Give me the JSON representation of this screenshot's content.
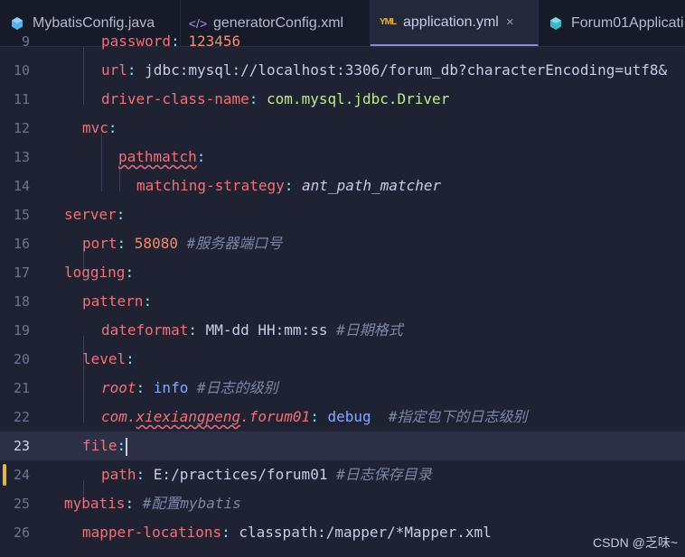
{
  "tabs": [
    {
      "label": "MybatisConfig.java",
      "icon": "java-class-icon",
      "active": false
    },
    {
      "label": "generatorConfig.xml",
      "icon": "xml-tag-icon",
      "active": false
    },
    {
      "label": "application.yml",
      "icon": "yaml-icon",
      "active": true,
      "close": "×"
    },
    {
      "label": "Forum01Applicati",
      "icon": "java-class-icon",
      "active": false
    }
  ],
  "yaml_icon_text": "YML",
  "editor": {
    "current_line": "23",
    "lines": [
      {
        "num": "9",
        "text": "password: 123456"
      },
      {
        "num": "10",
        "text": "url: jdbc:mysql://localhost:3306/forum_db?characterEncoding=utf8&"
      },
      {
        "num": "11",
        "text": "driver-class-name: com.mysql.jdbc.Driver"
      },
      {
        "num": "12",
        "text": "mvc:"
      },
      {
        "num": "13",
        "text": "pathmatch:"
      },
      {
        "num": "14",
        "text": "matching-strategy: ant_path_matcher"
      },
      {
        "num": "15",
        "text": "server:"
      },
      {
        "num": "16",
        "text": "port: 58080 #服务器端口号"
      },
      {
        "num": "17",
        "text": "logging:"
      },
      {
        "num": "18",
        "text": "pattern:"
      },
      {
        "num": "19",
        "text": "dateformat: MM-dd HH:mm:ss #日期格式"
      },
      {
        "num": "20",
        "text": "level:"
      },
      {
        "num": "21",
        "text": "root: info #日志的级别"
      },
      {
        "num": "22",
        "text": "com.xiexiangpeng.forum01: debug  #指定包下的日志级别"
      },
      {
        "num": "23",
        "text": "file:"
      },
      {
        "num": "24",
        "text": "path: E:/practices/forum01 #日志保存目录"
      },
      {
        "num": "25",
        "text": "mybatis: #配置mybatis"
      },
      {
        "num": "26",
        "text": "mapper-locations: classpath:/mapper/*Mapper.xml"
      }
    ]
  },
  "watermark": "CSDN @乏味~",
  "colors": {
    "key": "#f07178",
    "string": "#c3e88d",
    "number": "#f78c6c",
    "comment": "#7f86a6",
    "accent": "#8f87e8"
  }
}
